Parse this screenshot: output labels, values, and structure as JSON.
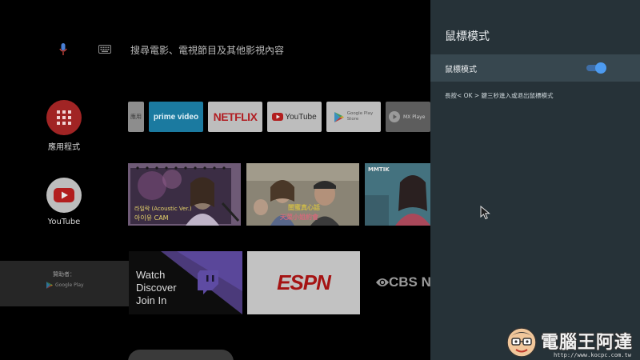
{
  "search": {
    "placeholder": "搜尋電影、電視節目及其他影視內容"
  },
  "left_nav": [
    {
      "label": "應用程式",
      "icon": "apps-grid-icon",
      "color": "#cc2b2b"
    },
    {
      "label": "YouTube",
      "icon": "youtube-icon",
      "color": "#c9c9c9"
    }
  ],
  "apps": [
    {
      "name": "應用",
      "label": "應用"
    },
    {
      "name": "prime video",
      "label": "prime video",
      "color": "#1a98c9"
    },
    {
      "name": "NETFLIX",
      "label": "NETFLIX",
      "color": "#d81f26"
    },
    {
      "name": "YouTube",
      "label": "YouTube"
    },
    {
      "name": "Google Play Store",
      "label": "Google Play\nStore"
    },
    {
      "name": "MX Player",
      "label": "MX Playe"
    }
  ],
  "videos": [
    {
      "caption_top": "라일락 (Acoustic Ver.)",
      "caption_bottom": "아이유 CAM"
    },
    {
      "caption_top": "閨蜜真心話",
      "caption_bottom": "天菜小姐約會"
    },
    {
      "caption_top": "MMTIK",
      "caption_bottom": ""
    }
  ],
  "sponsor": {
    "label": "贊助者：",
    "store": "Google Play"
  },
  "promos": {
    "twitch_text": [
      "Watch",
      "Discover",
      "Join In"
    ],
    "espn_text": "ESPN",
    "cbs_text": "CBS N"
  },
  "panel": {
    "title": "鼠標模式",
    "toggle_label": "鼠標模式",
    "toggle_on": true,
    "hint": "長按< OK > 鍵三秒進入或退出鼠標模式",
    "accent": "#4d9bf0"
  },
  "watermark": {
    "text": "電腦王阿達",
    "url": "http://www.kocpc.com.tw"
  }
}
